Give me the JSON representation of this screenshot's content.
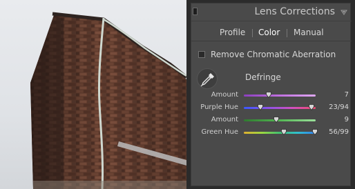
{
  "panel": {
    "title": "Lens Corrections",
    "tabs": [
      {
        "label": "Profile",
        "active": false
      },
      {
        "label": "Color",
        "active": true
      },
      {
        "label": "Manual",
        "active": false
      }
    ],
    "remove_ca": {
      "label": "Remove Chromatic Aberration",
      "checked": false
    },
    "defringe": {
      "label": "Defringe"
    },
    "sliders": [
      {
        "label": "Amount",
        "value": "7",
        "thumbs": [
          0.35
        ],
        "track": "linear-gradient(90deg,#8c3fbf,#c070e0,#e0a8f4)"
      },
      {
        "label": "Purple Hue",
        "value": "23/94",
        "thumbs": [
          0.23,
          0.94
        ],
        "track": "linear-gradient(90deg,#3a58ff,#8a52e8,#d050c0,#f04a70)"
      },
      {
        "label": "Amount",
        "value": "9",
        "thumbs": [
          0.45
        ],
        "track": "linear-gradient(90deg,#2f7a2f,#53b853,#9be09b)"
      },
      {
        "label": "Green Hue",
        "value": "56/99",
        "thumbs": [
          0.56,
          0.99
        ],
        "track": "linear-gradient(90deg,#e0b030,#9ed840,#40c070,#30c0d0,#3080f0)"
      }
    ]
  },
  "colors": {
    "panel_bg": "#4a4a4a",
    "panel_border": "#2b2b2b",
    "text": "#d8d8d8"
  }
}
